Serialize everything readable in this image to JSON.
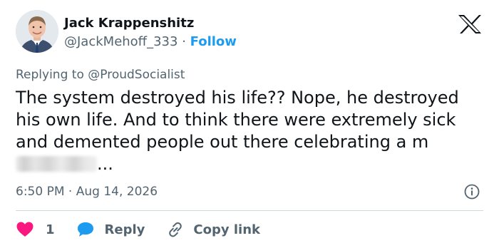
{
  "author": {
    "name": "Jack Krappenshitz",
    "handle": "@JackMehoff_333",
    "separator": "·",
    "follow_label": "Follow"
  },
  "platform_icon": "x-logo-icon",
  "reply_to": {
    "prefix": "Replying to",
    "handle": "@ProudSocialist"
  },
  "tweet": {
    "text": "The system destroyed his life?? Nope, he destroyed his own life. And to think there were extremely sick and demented people out there celebrating a m",
    "trailing": "..."
  },
  "meta": {
    "time": "6:50 PM",
    "separator": "·",
    "date": "Aug 14, 2026",
    "info_icon": "info-icon"
  },
  "actions": {
    "like": {
      "icon": "heart-icon",
      "count": "1",
      "color": "#f91880"
    },
    "reply": {
      "icon": "speech-bubble-icon",
      "label": "Reply",
      "color": "#1d9bf0"
    },
    "copy": {
      "icon": "link-icon",
      "label": "Copy link"
    }
  }
}
